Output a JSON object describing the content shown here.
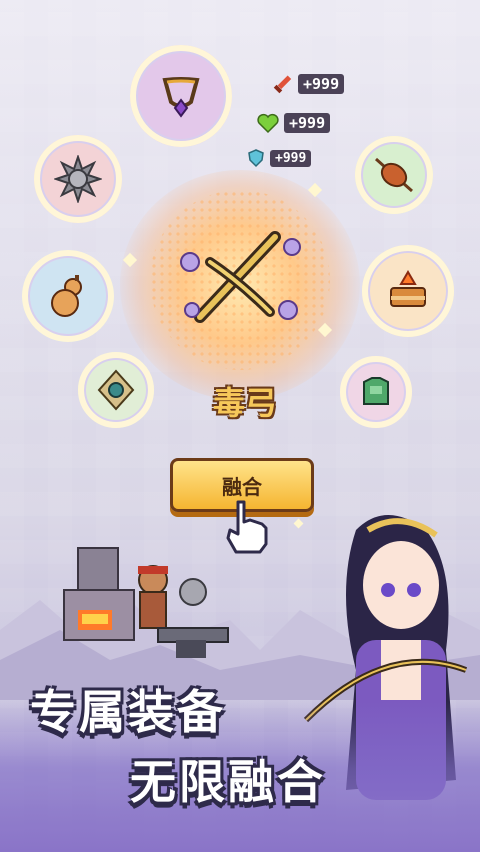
{
  "stats": [
    {
      "icon": "sword-icon",
      "value": "+999",
      "color": "#e0523a"
    },
    {
      "icon": "heart-icon",
      "value": "+999",
      "color": "#7ccf3c"
    },
    {
      "icon": "shield-icon",
      "value": "+999",
      "color": "#5fc2d9"
    }
  ],
  "equipment_slots": [
    {
      "name": "necklace-slot",
      "icon": "necklace-icon"
    },
    {
      "name": "spiked-ball-slot",
      "icon": "spiked-ball-icon"
    },
    {
      "name": "roast-meat-slot",
      "icon": "roast-meat-icon"
    },
    {
      "name": "gourd-slot",
      "icon": "gourd-icon"
    },
    {
      "name": "cake-slot",
      "icon": "cake-icon"
    },
    {
      "name": "amulet-slot",
      "icon": "amulet-icon"
    },
    {
      "name": "armor-slot",
      "icon": "armor-icon"
    }
  ],
  "center_item": {
    "icon": "crossbow-icon",
    "name": "毒弓"
  },
  "fuse_button": {
    "label": "融合"
  },
  "headline": {
    "line1": "专属装备",
    "line2": "无限融合"
  },
  "colors": {
    "accent": "#f5b531",
    "banner_bg": "#8a74c8",
    "outline": "#2e2a4a"
  }
}
